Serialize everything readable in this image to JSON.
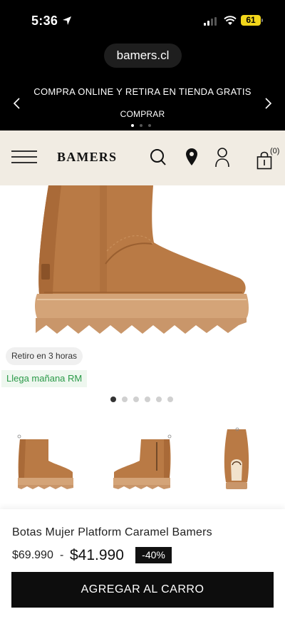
{
  "status_bar": {
    "time": "5:36",
    "battery": "61",
    "battery_color": "#f2d61b"
  },
  "browser": {
    "url": "bamers.cl"
  },
  "promo": {
    "text": "COMPRA ONLINE Y RETIRA EN TIENDA GRATIS",
    "cta": "COMPRAR",
    "slides": 3,
    "active_slide": 1
  },
  "header": {
    "logo": "BAMERS",
    "cart_count": "(0)",
    "background": "#f1ece3",
    "icons": [
      "menu-icon",
      "search-icon",
      "location-pin-icon",
      "user-icon",
      "cart-icon"
    ]
  },
  "product": {
    "badges": {
      "pickup": "Retiro en 3 horas",
      "delivery": "Llega mañana RM"
    },
    "gallery": {
      "images": 6,
      "active": 1,
      "thumbnails": [
        "boot-side-view",
        "boot-zipper-view",
        "boot-back-view"
      ]
    },
    "title": "Botas Mujer Platform Caramel Bamers",
    "price_old": "$69.990",
    "price_separator": "-",
    "price_new": "$41.990",
    "discount": "-40%",
    "add_to_cart": "AGREGAR AL CARRO",
    "boot_color": "#b97a45"
  }
}
